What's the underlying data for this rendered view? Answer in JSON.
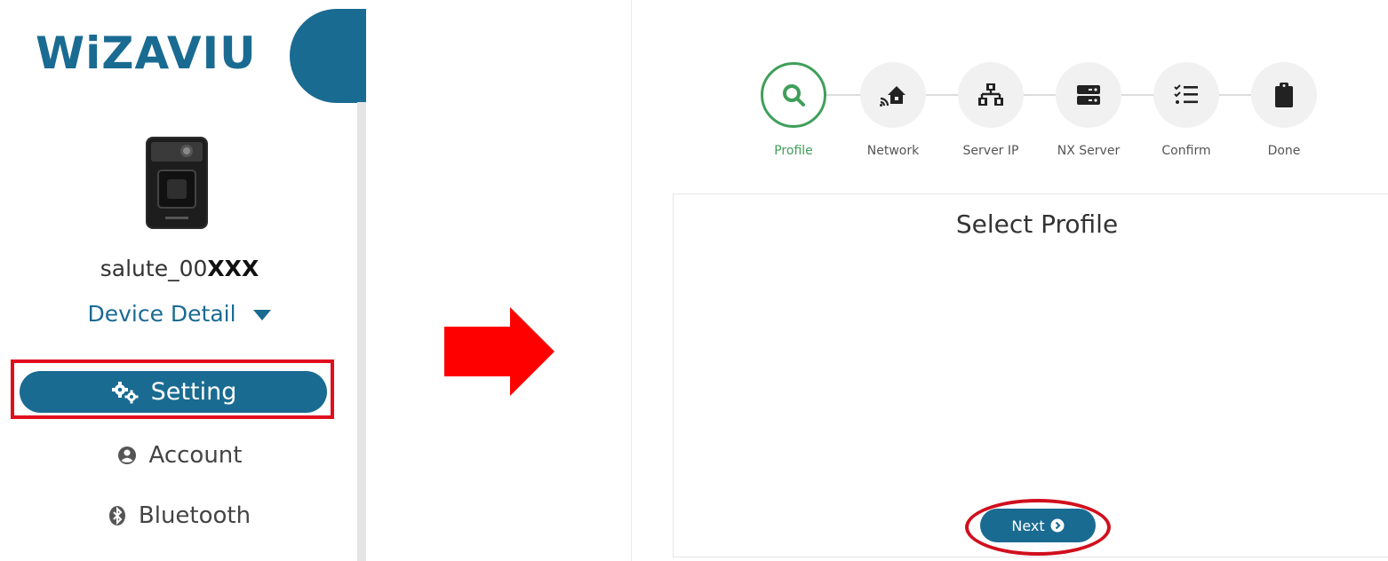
{
  "brand": {
    "logo_text": "WiZAVIU",
    "color": "#1a6b92"
  },
  "device": {
    "name_prefix": "salute_00",
    "name_suffix": "XXX",
    "detail_label": "Device Detail"
  },
  "sidebar": {
    "setting_label": "Setting",
    "account_label": "Account",
    "bluetooth_label": "Bluetooth"
  },
  "wizard": {
    "steps": [
      {
        "label": "Profile",
        "icon": "search-icon",
        "active": true
      },
      {
        "label": "Network",
        "icon": "network-house-icon",
        "active": false
      },
      {
        "label": "Server IP",
        "icon": "sitemap-icon",
        "active": false
      },
      {
        "label": "NX Server",
        "icon": "server-icon",
        "active": false
      },
      {
        "label": "Confirm",
        "icon": "checklist-icon",
        "active": false
      },
      {
        "label": "Done",
        "icon": "clipboard-icon",
        "active": false
      }
    ],
    "title": "Select Profile",
    "next_label": "Next"
  },
  "colors": {
    "highlight": "#e10f1d",
    "active_step": "#3f9f5a",
    "arrow": "#ff0000"
  }
}
